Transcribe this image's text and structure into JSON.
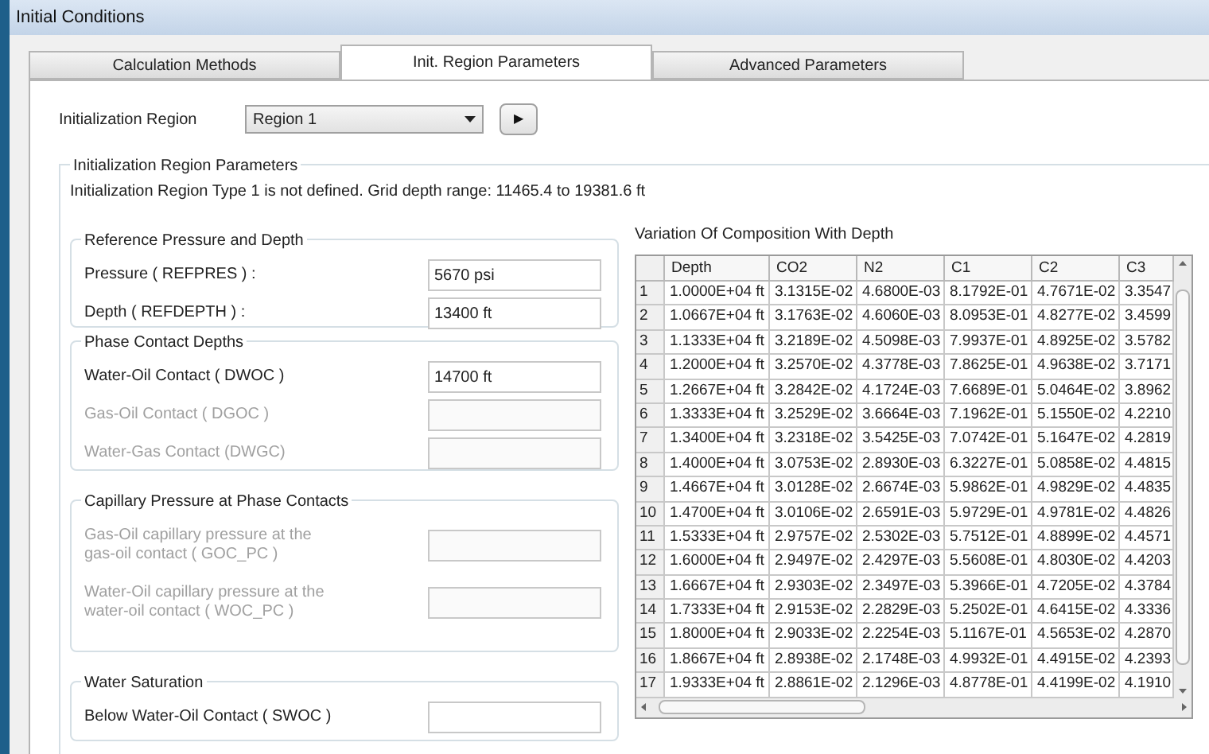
{
  "window": {
    "title": "Initial Conditions"
  },
  "tabs": [
    {
      "label": "Calculation Methods",
      "selected": false
    },
    {
      "label": "Init. Region Parameters",
      "selected": true
    },
    {
      "label": "Advanced Parameters",
      "selected": false
    }
  ],
  "region": {
    "label": "Initialization Region",
    "value": "Region 1",
    "next": "▶"
  },
  "params_group": {
    "title": "Initialization Region Parameters",
    "message": "Initialization Region Type 1 is not defined. Grid depth range: 11465.4 to 19381.6 ft"
  },
  "groups": [
    {
      "title": "Reference Pressure and Depth",
      "fields": [
        {
          "label": "Pressure ( REFPRES ) :",
          "value": "5670 psi",
          "disabled": false
        },
        {
          "label": "Depth ( REFDEPTH ) :",
          "value": "13400 ft",
          "disabled": false
        }
      ]
    },
    {
      "title": "Phase Contact Depths",
      "fields": [
        {
          "label": "Water-Oil Contact ( DWOC )",
          "value": "14700 ft",
          "disabled": false
        },
        {
          "label": "Gas-Oil Contact ( DGOC )",
          "disabled": true
        },
        {
          "label": "Water-Gas Contact (DWGC)",
          "disabled": true
        }
      ]
    },
    {
      "title": "Capillary Pressure at Phase Contacts",
      "fields": [
        {
          "label": "Gas-Oil capillary pressure at the gas-oil contact ( GOC_PC )",
          "disabled": true
        },
        {
          "label": "Water-Oil capillary pressure at the water-oil contact ( WOC_PC )",
          "disabled": true
        }
      ]
    },
    {
      "title": "Water Saturation",
      "fields": [
        {
          "label": "Below Water-Oil Contact ( SWOC )",
          "disabled": false
        }
      ]
    }
  ],
  "table": {
    "title": "Variation Of Composition With Depth",
    "columns": [
      "",
      "Depth",
      "CO2",
      "N2",
      "C1",
      "C2",
      "C3"
    ],
    "rows": [
      [
        "1",
        "1.0000E+04 ft",
        "3.1315E-02",
        "4.6800E-03",
        "8.1792E-01",
        "4.7671E-02",
        "3.3547"
      ],
      [
        "2",
        "1.0667E+04 ft",
        "3.1763E-02",
        "4.6060E-03",
        "8.0953E-01",
        "4.8277E-02",
        "3.4599"
      ],
      [
        "3",
        "1.1333E+04 ft",
        "3.2189E-02",
        "4.5098E-03",
        "7.9937E-01",
        "4.8925E-02",
        "3.5782"
      ],
      [
        "4",
        "1.2000E+04 ft",
        "3.2570E-02",
        "4.3778E-03",
        "7.8625E-01",
        "4.9638E-02",
        "3.7171"
      ],
      [
        "5",
        "1.2667E+04 ft",
        "3.2842E-02",
        "4.1724E-03",
        "7.6689E-01",
        "5.0464E-02",
        "3.8962"
      ],
      [
        "6",
        "1.3333E+04 ft",
        "3.2529E-02",
        "3.6664E-03",
        "7.1962E-01",
        "5.1550E-02",
        "4.2210"
      ],
      [
        "7",
        "1.3400E+04 ft",
        "3.2318E-02",
        "3.5425E-03",
        "7.0742E-01",
        "5.1647E-02",
        "4.2819"
      ],
      [
        "8",
        "1.4000E+04 ft",
        "3.0753E-02",
        "2.8930E-03",
        "6.3227E-01",
        "5.0858E-02",
        "4.4815"
      ],
      [
        "9",
        "1.4667E+04 ft",
        "3.0128E-02",
        "2.6674E-03",
        "5.9862E-01",
        "4.9829E-02",
        "4.4835"
      ],
      [
        "10",
        "1.4700E+04 ft",
        "3.0106E-02",
        "2.6591E-03",
        "5.9729E-01",
        "4.9781E-02",
        "4.4826"
      ],
      [
        "11",
        "1.5333E+04 ft",
        "2.9757E-02",
        "2.5302E-03",
        "5.7512E-01",
        "4.8899E-02",
        "4.4571"
      ],
      [
        "12",
        "1.6000E+04 ft",
        "2.9497E-02",
        "2.4297E-03",
        "5.5608E-01",
        "4.8030E-02",
        "4.4203"
      ],
      [
        "13",
        "1.6667E+04 ft",
        "2.9303E-02",
        "2.3497E-03",
        "5.3966E-01",
        "4.7205E-02",
        "4.3784"
      ],
      [
        "14",
        "1.7333E+04 ft",
        "2.9153E-02",
        "2.2829E-03",
        "5.2502E-01",
        "4.6415E-02",
        "4.3336"
      ],
      [
        "15",
        "1.8000E+04 ft",
        "2.9033E-02",
        "2.2254E-03",
        "5.1167E-01",
        "4.5653E-02",
        "4.2870"
      ],
      [
        "16",
        "1.8667E+04 ft",
        "2.8938E-02",
        "2.1748E-03",
        "4.9932E-01",
        "4.4915E-02",
        "4.2393"
      ],
      [
        "17",
        "1.9333E+04 ft",
        "2.8861E-02",
        "2.1296E-03",
        "4.8778E-01",
        "4.4199E-02",
        "4.1910"
      ]
    ]
  }
}
